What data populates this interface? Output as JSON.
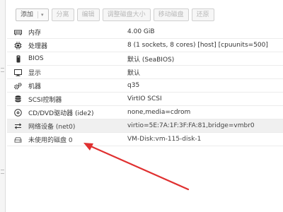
{
  "toolbar": {
    "add_label": "添加",
    "add_chevron": "▾",
    "detach_label": "分离",
    "edit_label": "编辑",
    "resize_disk_label": "调整磁盘大小",
    "move_disk_label": "移动磁盘",
    "revert_label": "还原"
  },
  "hardware": [
    {
      "icon": "memory-icon",
      "name": "内存",
      "value": "4.00 GiB"
    },
    {
      "icon": "cpu-icon",
      "name": "处理器",
      "value": "8 (1 sockets, 8 cores) [host] [cpuunits=500]"
    },
    {
      "icon": "bios-icon",
      "name": "BIOS",
      "value": "默认 (SeaBIOS)"
    },
    {
      "icon": "display-icon",
      "name": "显示",
      "value": "默认"
    },
    {
      "icon": "machine-icon",
      "name": "机器",
      "value": "q35"
    },
    {
      "icon": "storage-controller-icon",
      "name": "SCSI控制器",
      "value": "VirtIO SCSI"
    },
    {
      "icon": "cdrom-icon",
      "name": "CD/DVD驱动器 (ide2)",
      "value": "none,media=cdrom"
    },
    {
      "icon": "network-icon",
      "name": "网络设备 (net0)",
      "value": "virtio=5E:7A:1F:3F:FA:81,bridge=vmbr0"
    },
    {
      "icon": "hard-disk-icon",
      "name": "未使用的磁盘 0",
      "value": "VM-Disk:vm-115-disk-1"
    }
  ],
  "annotation_color": "#e03030"
}
